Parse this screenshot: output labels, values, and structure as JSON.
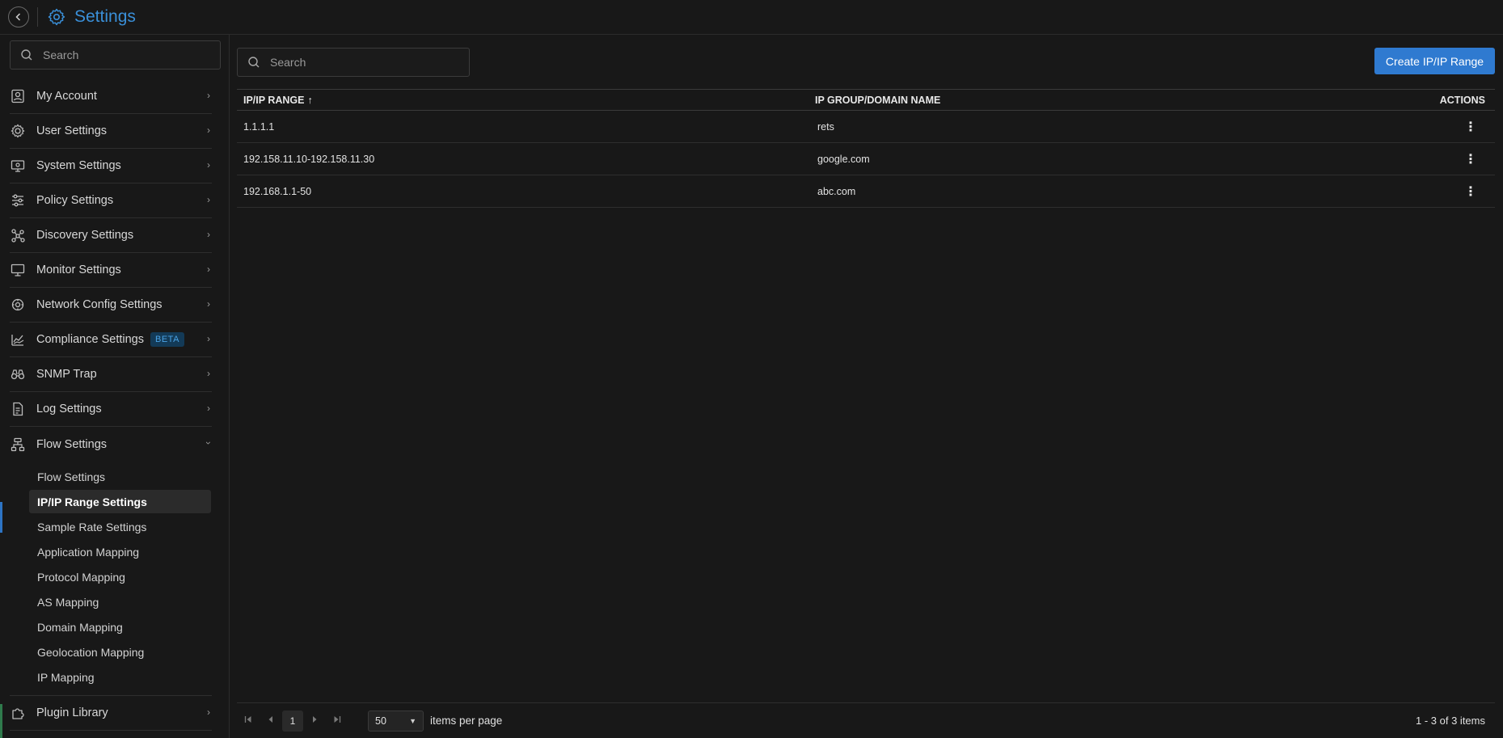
{
  "header": {
    "title": "Settings",
    "accent_color": "#3a8fd8"
  },
  "sidebar": {
    "search_placeholder": "Search",
    "items": [
      {
        "label": "My Account",
        "icon": "account-icon"
      },
      {
        "label": "User Settings",
        "icon": "user-settings-icon"
      },
      {
        "label": "System Settings",
        "icon": "system-settings-icon"
      },
      {
        "label": "Policy Settings",
        "icon": "sliders-icon"
      },
      {
        "label": "Discovery Settings",
        "icon": "network-nodes-icon"
      },
      {
        "label": "Monitor Settings",
        "icon": "monitor-icon"
      },
      {
        "label": "Network Config Settings",
        "icon": "network-config-icon"
      },
      {
        "label": "Compliance Settings",
        "icon": "compliance-chart-icon",
        "badge": "BETA"
      },
      {
        "label": "SNMP Trap",
        "icon": "binoculars-icon"
      },
      {
        "label": "Log Settings",
        "icon": "document-icon"
      },
      {
        "label": "Flow Settings",
        "icon": "flow-icon",
        "expanded": true
      }
    ],
    "flow_sub_items": [
      {
        "label": "Flow Settings"
      },
      {
        "label": "IP/IP Range Settings",
        "active": true
      },
      {
        "label": "Sample Rate Settings"
      },
      {
        "label": "Application Mapping"
      },
      {
        "label": "Protocol Mapping"
      },
      {
        "label": "AS Mapping"
      },
      {
        "label": "Domain Mapping"
      },
      {
        "label": "Geolocation Mapping"
      },
      {
        "label": "IP Mapping"
      }
    ],
    "after_items": [
      {
        "label": "Plugin Library",
        "icon": "plugin-icon"
      }
    ]
  },
  "main": {
    "search_placeholder": "Search",
    "create_button": "Create IP/IP Range",
    "table": {
      "headers": [
        "IP/IP RANGE",
        "IP GROUP/DOMAIN NAME",
        "ACTIONS"
      ],
      "sort_indicator": "↑",
      "rows": [
        [
          "1.1.1.1",
          "rets"
        ],
        [
          "192.158.11.10-192.158.11.30",
          "google.com"
        ],
        [
          "192.168.1.1-50",
          "abc.com"
        ]
      ]
    },
    "pager": {
      "current_page": "1",
      "page_size": "50",
      "items_per_page_label": "items per page",
      "info": "1 - 3 of 3 items"
    }
  }
}
